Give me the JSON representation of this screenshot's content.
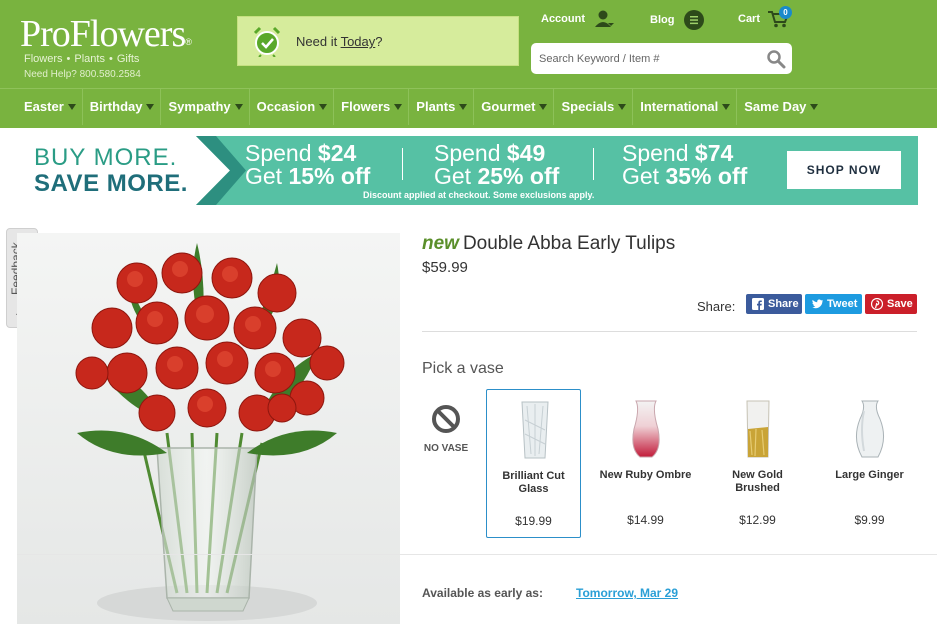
{
  "brand": {
    "logo": "ProFlowers",
    "logo_mark": "®",
    "categories": [
      "Flowers",
      "Plants",
      "Gifts"
    ],
    "help_text": "Need Help? 800.580.2584"
  },
  "delivery_promo": {
    "prefix": "Need it ",
    "link": "Today",
    "suffix": "?"
  },
  "top_links": {
    "account": "Account",
    "blog": "Blog",
    "cart": "Cart",
    "cart_count": "0"
  },
  "search": {
    "placeholder": "Search Keyword / Item #"
  },
  "nav": [
    "Easter",
    "Birthday",
    "Sympathy",
    "Occasion",
    "Flowers",
    "Plants",
    "Gourmet",
    "Specials",
    "International",
    "Same Day"
  ],
  "banner": {
    "line1": "BUY MORE.",
    "line2": "SAVE MORE.",
    "tiers": [
      {
        "spend_prefix": "Spend ",
        "spend": "$24",
        "get_prefix": "Get ",
        "get": "15% off"
      },
      {
        "spend_prefix": "Spend ",
        "spend": "$49",
        "get_prefix": "Get ",
        "get": "25% off"
      },
      {
        "spend_prefix": "Spend ",
        "spend": "$74",
        "get_prefix": "Get ",
        "get": "35% off"
      }
    ],
    "note": "Discount applied at checkout. Some exclusions apply.",
    "cta": "SHOP NOW"
  },
  "feedback": "Feedback",
  "product": {
    "badge": "new",
    "name": "Double Abba Early Tulips",
    "price": "$59.99",
    "share_label": "Share:",
    "share": {
      "facebook": "Share",
      "twitter": "Tweet",
      "pinterest": "Save"
    },
    "pick_vase_label": "Pick a vase",
    "no_vase_label": "NO VASE",
    "vases": [
      {
        "name": "Brilliant Cut Glass",
        "price": "$19.99",
        "selected": true
      },
      {
        "name": "New Ruby Ombre",
        "price": "$14.99",
        "selected": false
      },
      {
        "name": "New Gold Brushed",
        "price": "$12.99",
        "selected": false
      },
      {
        "name": "Large Ginger",
        "price": "$9.99",
        "selected": false
      }
    ],
    "availability_label": "Available as early as:",
    "availability_date": "Tomorrow, Mar 29"
  },
  "colors": {
    "header_green": "#79b33f",
    "banner_teal": "#56c1a4",
    "link_blue": "#2a9fd6",
    "new_green": "#5a8f2a"
  }
}
